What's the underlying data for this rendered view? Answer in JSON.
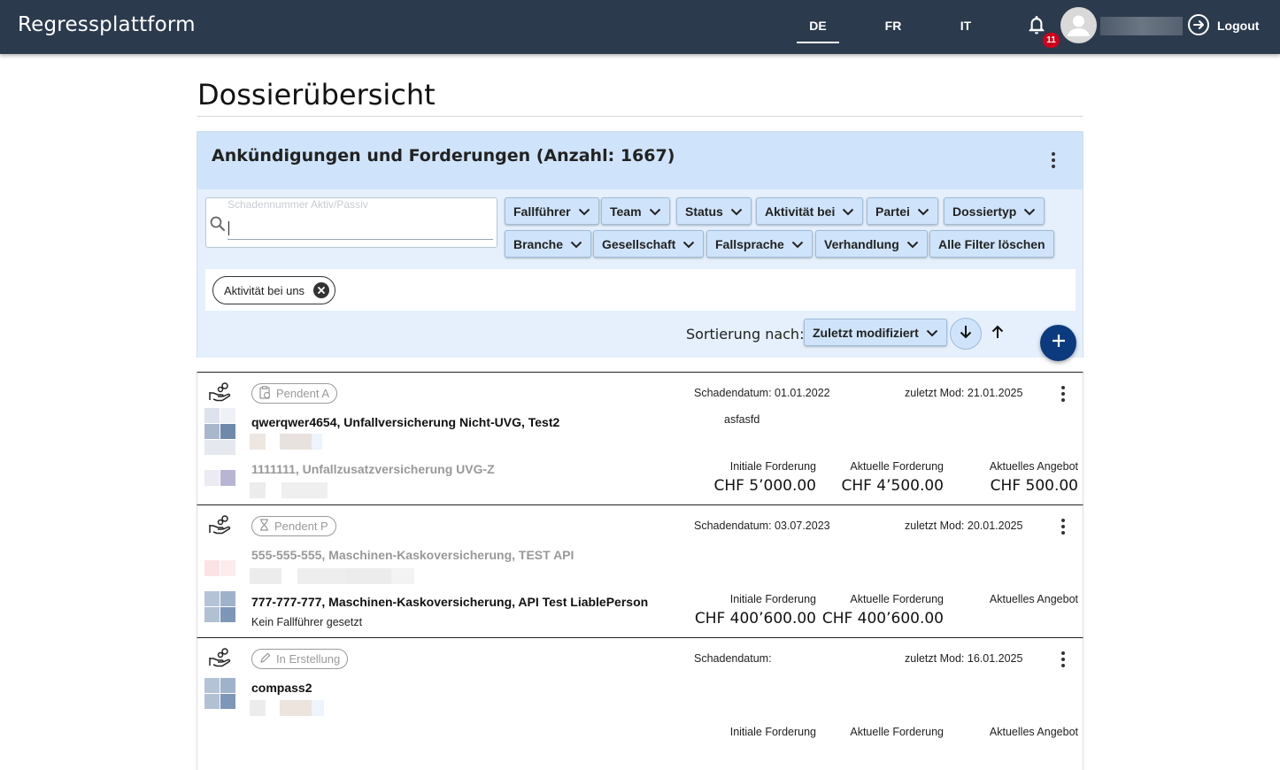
{
  "header": {
    "app_title": "Regressplattform",
    "languages": [
      "DE",
      "FR",
      "IT"
    ],
    "active_language": "DE",
    "notification_count": "11",
    "logout_label": "Logout"
  },
  "page": {
    "title": "Dossierübersicht"
  },
  "panel": {
    "title_prefix": "Ankündigungen und Forderungen (Anzahl: ",
    "count": "1667",
    "title_suffix": ")",
    "search_placeholder": "Schadennummer Aktiv/Passiv",
    "filters_row1": [
      "Fallführer",
      "Team",
      "Status",
      "Aktivität bei",
      "Partei",
      "Dossiertyp"
    ],
    "filters_row2": [
      "Branche",
      "Gesellschaft",
      "Fallsprache",
      "Verhandlung"
    ],
    "clear_filters_label": "Alle Filter löschen",
    "active_filter": "Aktivität bei uns",
    "sort_label": "Sortierung nach:",
    "sort_value": "Zuletzt modifiziert"
  },
  "cards": [
    {
      "status": "Pendent A",
      "damage_date": "Schadendatum: 01.01.2022",
      "last_mod": "zuletzt Mod: 21.01.2025",
      "dossier1": "qwerqwer4654, Unfallversicherung Nicht-UVG, Test2",
      "note": "asfasfd",
      "dossier2": "1111111, Unfallzusatzversicherung UVG-Z",
      "h_initial": "Initiale Forderung",
      "h_current": "Aktuelle Forderung",
      "h_offer": "Aktuelles Angebot",
      "v_initial": "CHF 5’000.00",
      "v_current": "CHF 4’500.00",
      "v_offer": "CHF 500.00"
    },
    {
      "status": "Pendent P",
      "damage_date": "Schadendatum: 03.07.2023",
      "last_mod": "zuletzt Mod: 20.01.2025",
      "dossier1": "555-555-555, Maschinen-Kaskoversicherung, TEST API",
      "dossier2": "777-777-777, Maschinen-Kaskoversicherung, API Test LiablePerson",
      "sub": "Kein Fallführer gesetzt",
      "h_initial": "Initiale Forderung",
      "h_current": "Aktuelle Forderung",
      "h_offer": "Aktuelles Angebot",
      "v_initial": "CHF 400’600.00",
      "v_current": "CHF 400’600.00",
      "v_offer": ""
    },
    {
      "status": "In Erstellung",
      "damage_date": "Schadendatum:",
      "last_mod": "zuletzt Mod: 16.01.2025",
      "dossier1": "compass2",
      "h_initial": "Initiale Forderung",
      "h_current": "Aktuelle Forderung",
      "h_offer": "Aktuelles Angebot"
    }
  ],
  "colors": {
    "topbar": "#2b3a4d",
    "panel": "#e5f0fc",
    "panel_head": "#cfe4fa",
    "fab": "#0b3a7e",
    "badge": "#d0021b"
  },
  "icons": [
    "bell-icon",
    "user-avatar-icon",
    "logout-icon",
    "search-icon",
    "chevron-down-icon",
    "close-icon",
    "arrow-down-icon",
    "arrow-up-icon",
    "plus-icon",
    "hand-coins-icon",
    "clipboard-clock-icon",
    "hourglass-icon",
    "pencil-icon",
    "more-vert-icon"
  ]
}
